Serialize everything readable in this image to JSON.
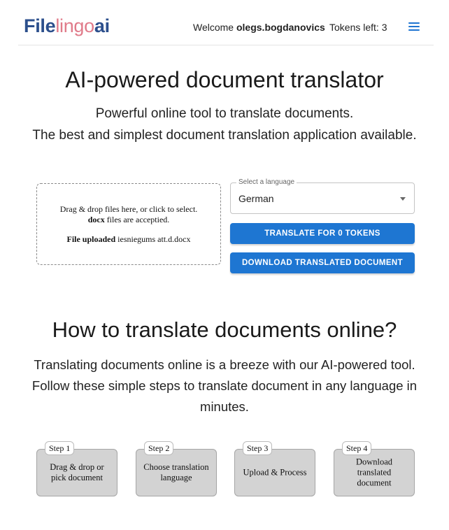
{
  "header": {
    "logo": {
      "part1": "File",
      "part2": "lingo",
      "part3": "ai"
    },
    "welcome_prefix": "Welcome",
    "username": "olegs.bogdanovics",
    "tokens_label": "Tokens left: 3"
  },
  "hero": {
    "title": "AI-powered document translator",
    "subtitle1": "Powerful online tool to translate documents.",
    "subtitle2": "The best and simplest document translation application available."
  },
  "upload": {
    "line1": "Drag & drop files here, or click to select.",
    "ext": "docx",
    "line2_suffix": " files are acceptied.",
    "uploaded_label": "File uploaded",
    "uploaded_file": " iesniegums att.d.docx"
  },
  "language_select": {
    "label": "Select a language",
    "value": "German"
  },
  "buttons": {
    "translate": "Translate for 0 tokens",
    "download": "Download translated document"
  },
  "how": {
    "title": "How to translate documents online?",
    "text": "Translating documents online is a breeze with our AI-powered tool. Follow these simple steps to translate document in any language in minutes."
  },
  "steps": [
    {
      "badge": "Step 1",
      "text": "Drag & drop or pick document"
    },
    {
      "badge": "Step 2",
      "text": "Choose translation language"
    },
    {
      "badge": "Step 3",
      "text": "Upload & Process"
    },
    {
      "badge": "Step 4",
      "text": "Download translated document"
    }
  ],
  "colors": {
    "primary": "#1e76d2",
    "logo_dark": "#2c4f8c",
    "logo_accent": "#e07b8a",
    "step_bg": "#d3d3d3"
  },
  "icons": {
    "menu": "hamburger-menu-icon",
    "select_arrow": "caret-down-icon"
  }
}
